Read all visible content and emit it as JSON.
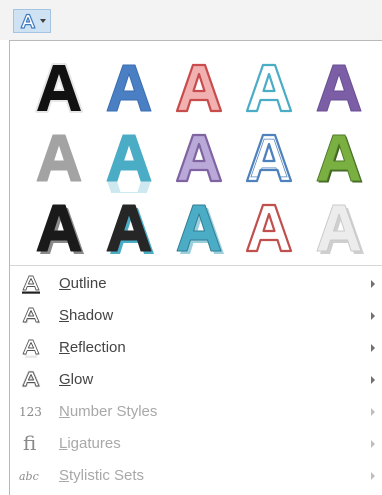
{
  "effects_button": {
    "icon": "text-effects-a-icon",
    "caret": "chevron-down-icon"
  },
  "gallery": {
    "glyph": "A",
    "rows": [
      [
        {
          "fill": "#111111",
          "stroke": "#ffffff",
          "effect": "glow-white"
        },
        {
          "fill": "#4a7fc4",
          "stroke": "#3a6db0",
          "effect": "plain"
        },
        {
          "fill": "#f2b1b1",
          "stroke": "#c94c4c",
          "effect": "outline"
        },
        {
          "fill": "#ffffff",
          "stroke": "#4bacc6",
          "effect": "outline"
        },
        {
          "fill": "#7b5ea6",
          "stroke": "#6a4f93",
          "effect": "plain"
        }
      ],
      [
        {
          "fill": "#a3a3a3",
          "stroke": "#a3a3a3",
          "effect": "plain"
        },
        {
          "fill": "#4bacc6",
          "stroke": "#4bacc6",
          "effect": "reflection"
        },
        {
          "fill": "#b9a9d8",
          "stroke": "#8064a2",
          "effect": "outline"
        },
        {
          "fill": "#ffffff",
          "stroke": "#4f81bd",
          "effect": "double-outline"
        },
        {
          "fill": "#7ab041",
          "stroke": "#4f7a28",
          "effect": "bevel"
        }
      ],
      [
        {
          "fill": "#1a1a1a",
          "stroke": "#1a1a1a",
          "effect": "shadow-dark"
        },
        {
          "fill": "#262626",
          "stroke": "#262626",
          "effect": "shadow-cyan"
        },
        {
          "fill": "#4bacc6",
          "stroke": "#2f7d92",
          "effect": "shadow-blue"
        },
        {
          "fill": "#ffffff",
          "stroke": "#c0504d",
          "effect": "outline"
        },
        {
          "fill": "#ececec",
          "stroke": "#c9c9c9",
          "effect": "shadow-light"
        }
      ]
    ]
  },
  "menu_items": [
    {
      "label": "Outline",
      "icon": "outline-a-icon",
      "enabled": true
    },
    {
      "label": "Shadow",
      "icon": "shadow-a-icon",
      "enabled": true
    },
    {
      "label": "Reflection",
      "icon": "reflection-a-icon",
      "enabled": true
    },
    {
      "label": "Glow",
      "icon": "glow-a-icon",
      "enabled": true
    },
    {
      "label": "Number Styles",
      "icon": "number-styles-icon",
      "enabled": false,
      "icon_text": "123"
    },
    {
      "label": "Ligatures",
      "icon": "ligatures-icon",
      "enabled": false,
      "icon_text": "fi"
    },
    {
      "label": "Stylistic Sets",
      "icon": "stylistic-sets-icon",
      "enabled": false,
      "icon_text": "abc"
    }
  ],
  "colors": {
    "accent": "#cfe2f3",
    "accent_border": "#a4c4e2",
    "text": "#444444",
    "disabled": "#a8a8a8"
  }
}
